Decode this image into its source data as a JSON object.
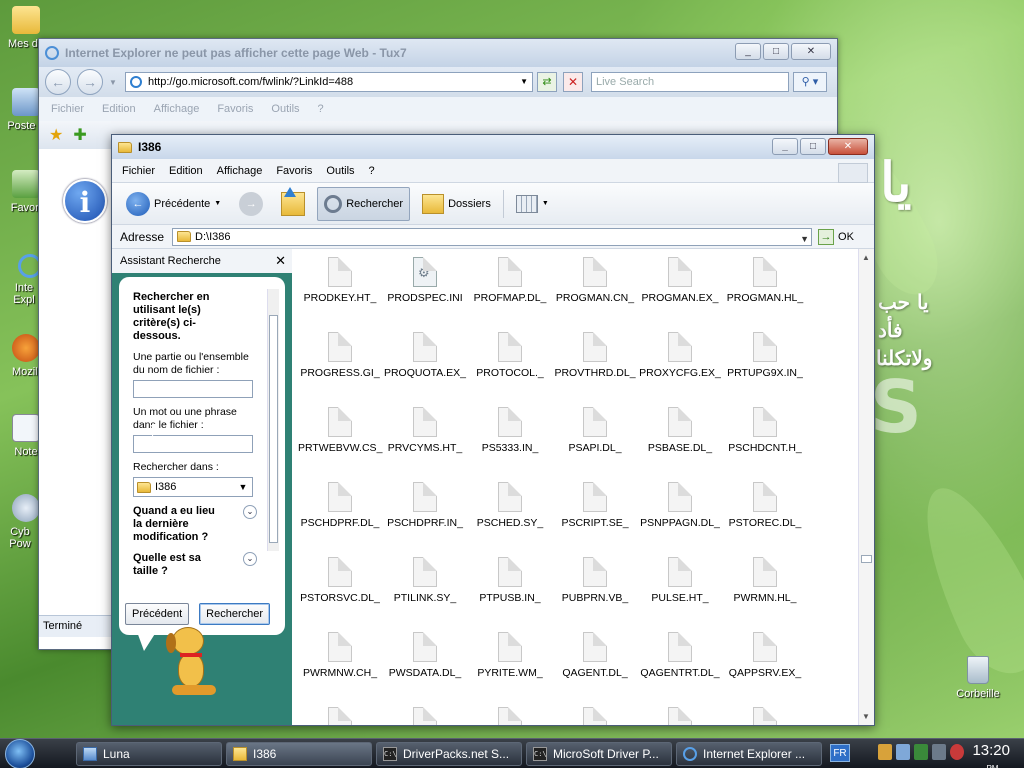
{
  "desktop": {
    "icons": [
      "Mes do",
      "Poste d",
      "Favori",
      "Inte Expl",
      "Mozill",
      "Note",
      "Cyb Pow"
    ],
    "recycle_bin": "Corbeille",
    "wallpaper_text": [
      "يا",
      "يا حب",
      "فأد",
      "ولاتكلنا",
      "S"
    ]
  },
  "ie_window": {
    "title": "Internet Explorer ne peut pas afficher cette page Web - Tux7",
    "url": "http://go.microsoft.com/fwlink/?LinkId=488",
    "search_placeholder": "Live Search",
    "menu": [
      "Fichier",
      "Edition",
      "Affichage",
      "Favoris",
      "Outils",
      "?"
    ],
    "status": "Terminé",
    "icons": [
      "back-icon",
      "forward-icon",
      "refresh-icon",
      "stop-icon",
      "search-icon",
      "star-icon",
      "add-favorite-icon",
      "info-icon"
    ]
  },
  "explorer": {
    "title": "I386",
    "menu": [
      "Fichier",
      "Edition",
      "Affichage",
      "Favoris",
      "Outils",
      "?"
    ],
    "toolbar": {
      "back": "Précédente",
      "search": "Rechercher",
      "folders": "Dossiers"
    },
    "address_label": "Adresse",
    "address_value": "D:\\I386",
    "go_label": "OK",
    "search_pane": {
      "header": "Assistant Recherche",
      "heading": "Rechercher en utilisant le(s) critère(s) ci-dessous.",
      "name_label": "Une partie ou l'ensemble du nom de fichier :",
      "phrase_label": "Un mot ou une phrase dans le fichier :",
      "look_in_label": "Rechercher dans :",
      "look_in_value": "I386",
      "when_modified": "Quand a eu lieu la dernière modification ?",
      "size_question": "Quelle est sa taille ?",
      "back_button": "Précédent",
      "search_button": "Rechercher"
    },
    "files": [
      {
        "name": "PRODKEY.HT_",
        "type": "file"
      },
      {
        "name": "PRODSPEC.INI",
        "type": "ini"
      },
      {
        "name": "PROFMAP.DL_",
        "type": "file"
      },
      {
        "name": "PROGMAN.CN_",
        "type": "file"
      },
      {
        "name": "PROGMAN.EX_",
        "type": "file"
      },
      {
        "name": "PROGMAN.HL_",
        "type": "file"
      },
      {
        "name": "PROGRESS.GI_",
        "type": "file"
      },
      {
        "name": "PROQUOTA.EX_",
        "type": "file"
      },
      {
        "name": "PROTOCOL._",
        "type": "file"
      },
      {
        "name": "PROVTHRD.DL_",
        "type": "file"
      },
      {
        "name": "PROXYCFG.EX_",
        "type": "file"
      },
      {
        "name": "PRTUPG9X.IN_",
        "type": "file"
      },
      {
        "name": "PRTWEBVW.CS_",
        "type": "file"
      },
      {
        "name": "PRVCYMS.HT_",
        "type": "file"
      },
      {
        "name": "PS5333.IN_",
        "type": "file"
      },
      {
        "name": "PSAPI.DL_",
        "type": "file"
      },
      {
        "name": "PSBASE.DL_",
        "type": "file"
      },
      {
        "name": "PSCHDCNT.H_",
        "type": "file"
      },
      {
        "name": "PSCHDPRF.DL_",
        "type": "file"
      },
      {
        "name": "PSCHDPRF.IN_",
        "type": "file"
      },
      {
        "name": "PSCHED.SY_",
        "type": "file"
      },
      {
        "name": "PSCRIPT.SE_",
        "type": "file"
      },
      {
        "name": "PSNPPAGN.DL_",
        "type": "file"
      },
      {
        "name": "PSTOREC.DL_",
        "type": "file"
      },
      {
        "name": "PSTORSVC.DL_",
        "type": "file"
      },
      {
        "name": "PTILINK.SY_",
        "type": "file"
      },
      {
        "name": "PTPUSB.IN_",
        "type": "file"
      },
      {
        "name": "PUBPRN.VB_",
        "type": "file"
      },
      {
        "name": "PULSE.HT_",
        "type": "file"
      },
      {
        "name": "PWRMN.HL_",
        "type": "file"
      },
      {
        "name": "PWRMNW.CH_",
        "type": "file"
      },
      {
        "name": "PWSDATA.DL_",
        "type": "file"
      },
      {
        "name": "PYRITE.WM_",
        "type": "file"
      },
      {
        "name": "QAGENT.DL_",
        "type": "file"
      },
      {
        "name": "QAGENTRT.DL_",
        "type": "file"
      },
      {
        "name": "QAPPSRV.EX_",
        "type": "file"
      },
      {
        "name": "",
        "type": "file"
      },
      {
        "name": "",
        "type": "file"
      },
      {
        "name": "",
        "type": "file"
      },
      {
        "name": "",
        "type": "file"
      },
      {
        "name": "",
        "type": "file"
      },
      {
        "name": "",
        "type": "file"
      }
    ]
  },
  "taskbar": {
    "tasks": [
      {
        "label": "Luna",
        "icon": "luna-icon"
      },
      {
        "label": "I386",
        "icon": "folder-icon"
      },
      {
        "label": "DriverPacks.net S...",
        "icon": "cmd-icon"
      },
      {
        "label": "MicroSoft Driver P...",
        "icon": "cmd-icon"
      },
      {
        "label": "Internet Explorer ...",
        "icon": "ie-icon"
      }
    ],
    "language": "FR",
    "clock": "13:20",
    "clock_ampm": "PM"
  }
}
